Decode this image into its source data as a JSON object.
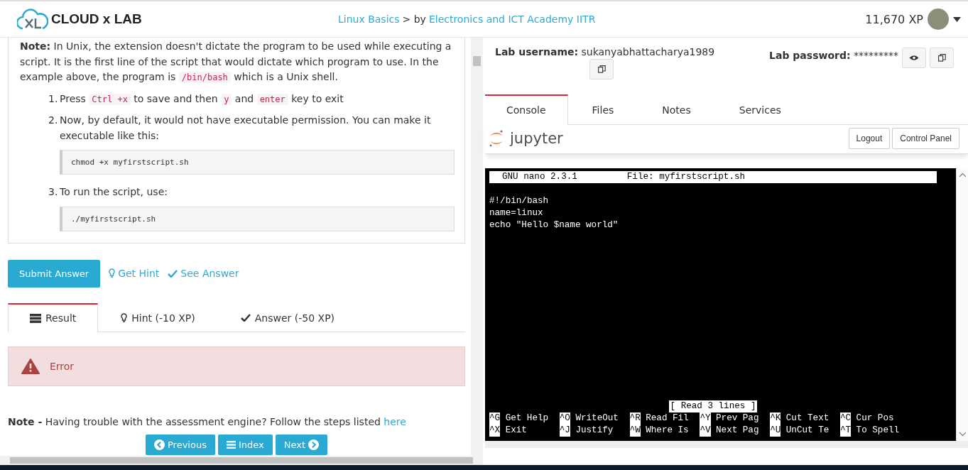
{
  "header": {
    "logo_text": "CLOUD x LAB",
    "breadcrumb": {
      "course": "Linux Basics",
      "separator": "> by",
      "provider": "Electronics and ICT Academy IITR"
    },
    "xp": "11,670 XP"
  },
  "lesson": {
    "note": {
      "label": "Note:",
      "segments": [
        {
          "kind": "text",
          "text": "In Unix, the extension doesn't dictate the program to be used while executing a script. It is the first line of the script that would dictate which program to use. In the example above, the program is "
        },
        {
          "kind": "code",
          "text": "/bin/bash"
        },
        {
          "kind": "text",
          "text": " which is a Unix shell."
        }
      ]
    },
    "steps": [
      {
        "number": "1.",
        "segments": [
          {
            "kind": "text",
            "text": "Press "
          },
          {
            "kind": "code",
            "text": "Ctrl +x"
          },
          {
            "kind": "text",
            "text": " to save and then "
          },
          {
            "kind": "code",
            "text": "y"
          },
          {
            "kind": "text",
            "text": " and "
          },
          {
            "kind": "code",
            "text": "enter"
          },
          {
            "kind": "text",
            "text": " key to exit"
          }
        ]
      },
      {
        "number": "2.",
        "segments": [
          {
            "kind": "text",
            "text": "Now, by default, it would not have executable permission. You can make it executable like this:"
          }
        ],
        "code_block": "chmod +x myfirstscript.sh"
      },
      {
        "number": "3.",
        "segments": [
          {
            "kind": "text",
            "text": "To run the script, use:"
          }
        ],
        "code_block": "./myfirstscript.sh"
      }
    ]
  },
  "actions": {
    "submit": "Submit Answer",
    "hint": "Get Hint",
    "answer": "See Answer"
  },
  "result_tabs": [
    {
      "label": "Result",
      "kind": "result",
      "selected": true
    },
    {
      "label": "Hint (-10 XP)",
      "kind": "hint",
      "selected": false
    },
    {
      "label": "Answer (-50 XP)",
      "kind": "answer",
      "selected": false
    }
  ],
  "alert": {
    "text": "Error"
  },
  "footer_note": {
    "label": "Note -",
    "text": "Having trouble with the assessment engine? Follow the steps listed ",
    "link": "here"
  },
  "nav": [
    {
      "label": "Previous",
      "kind": "previous"
    },
    {
      "label": "Index",
      "kind": "index"
    },
    {
      "label": "Next",
      "kind": "next"
    }
  ],
  "lab": {
    "username_label": "Lab username:",
    "username": "sukanyabhattacharya1989",
    "password_label": "Lab password:",
    "password": "*********",
    "tabs": [
      {
        "label": "Console",
        "selected": true
      },
      {
        "label": "Files",
        "selected": false
      },
      {
        "label": "Notes",
        "selected": false
      },
      {
        "label": "Services",
        "selected": false
      }
    ],
    "jupyter": {
      "brand": "jupyter",
      "buttons": [
        "Logout",
        "Control Panel"
      ]
    }
  },
  "terminal": {
    "title_left": "GNU nano 2.3.1",
    "title_right": "File: myfirstscript.sh",
    "lines": [
      "#!/bin/bash",
      "name=linux",
      "echo \"Hello $name world\""
    ],
    "status": "[ Read 3 lines ]",
    "shortcuts": [
      [
        {
          "key": "^G",
          "label": "Get Help"
        },
        {
          "key": "^O",
          "label": "WriteOut"
        },
        {
          "key": "^R",
          "label": "Read Fil"
        },
        {
          "key": "^Y",
          "label": "Prev Pag"
        },
        {
          "key": "^K",
          "label": "Cut Text"
        },
        {
          "key": "^C",
          "label": "Cur Pos"
        }
      ],
      [
        {
          "key": "^X",
          "label": "Exit"
        },
        {
          "key": "^J",
          "label": "Justify"
        },
        {
          "key": "^W",
          "label": "Where Is"
        },
        {
          "key": "^V",
          "label": "Next Pag"
        },
        {
          "key": "^U",
          "label": "UnCut Te"
        },
        {
          "key": "^T",
          "label": "To Spell"
        }
      ]
    ]
  }
}
